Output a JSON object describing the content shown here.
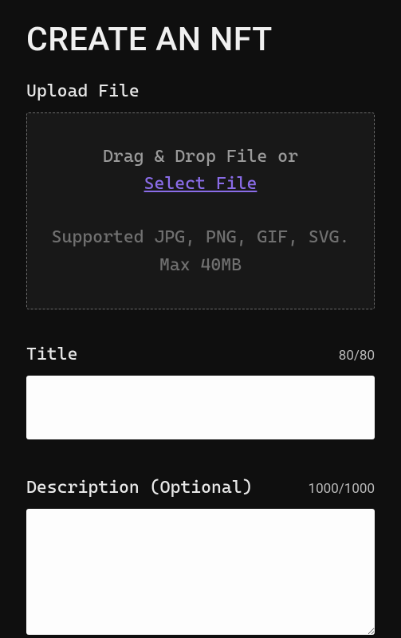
{
  "header": {
    "title": "CREATE AN NFT"
  },
  "upload": {
    "label": "Upload File",
    "dropzone_text": "Drag & Drop File or",
    "select_link": "Select File",
    "supported_text": "Supported JPG, PNG, GIF, SVG. Max 40MB"
  },
  "title_field": {
    "label": "Title",
    "counter": "80/80",
    "value": ""
  },
  "description_field": {
    "label": "Description (Optional)",
    "counter": "1000/1000",
    "value": ""
  }
}
